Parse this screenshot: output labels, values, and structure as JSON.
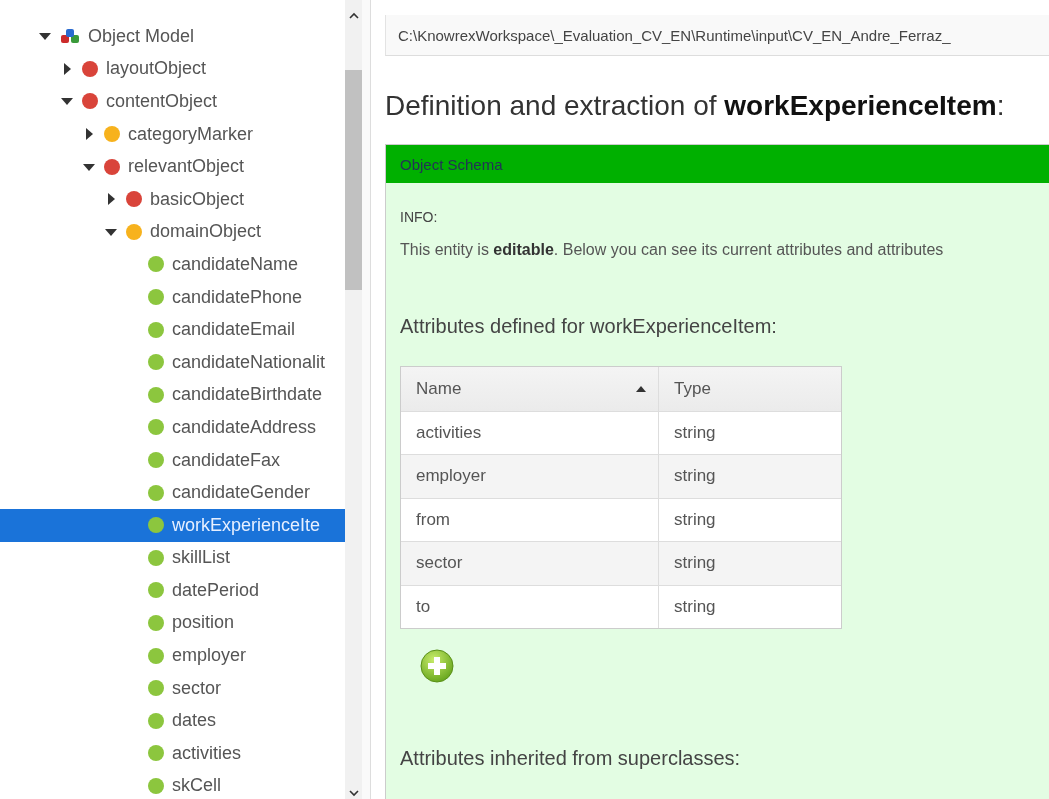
{
  "tree": [
    {
      "label": "Object Model",
      "kind": "model",
      "expanded": true,
      "selected": false,
      "children": [
        {
          "label": "layoutObject",
          "color": "#d9443a",
          "expanded": false,
          "selected": false
        },
        {
          "label": "contentObject",
          "color": "#d9443a",
          "expanded": true,
          "selected": false,
          "children": [
            {
              "label": "categoryMarker",
              "color": "#f7b21d",
              "expanded": false,
              "selected": false
            },
            {
              "label": "relevantObject",
              "color": "#d9443a",
              "expanded": true,
              "selected": false,
              "children": [
                {
                  "label": "basicObject",
                  "color": "#d9443a",
                  "expanded": false,
                  "selected": false
                },
                {
                  "label": "domainObject",
                  "color": "#f7b21d",
                  "expanded": true,
                  "selected": false,
                  "children": [
                    {
                      "label": "candidateName",
                      "color": "#8cc63e",
                      "selected": false
                    },
                    {
                      "label": "candidatePhone",
                      "color": "#8cc63e",
                      "selected": false
                    },
                    {
                      "label": "candidateEmail",
                      "color": "#8cc63e",
                      "selected": false
                    },
                    {
                      "label": "candidateNationalit",
                      "color": "#8cc63e",
                      "selected": false
                    },
                    {
                      "label": "candidateBirthdate",
                      "color": "#8cc63e",
                      "selected": false
                    },
                    {
                      "label": "candidateAddress",
                      "color": "#8cc63e",
                      "selected": false
                    },
                    {
                      "label": "candidateFax",
                      "color": "#8cc63e",
                      "selected": false
                    },
                    {
                      "label": "candidateGender",
                      "color": "#8cc63e",
                      "selected": false
                    },
                    {
                      "label": "workExperienceIte",
                      "color": "#8cc63e",
                      "selected": true
                    },
                    {
                      "label": "skillList",
                      "color": "#8cc63e",
                      "selected": false
                    },
                    {
                      "label": "datePeriod",
                      "color": "#8cc63e",
                      "selected": false
                    },
                    {
                      "label": "position",
                      "color": "#8cc63e",
                      "selected": false
                    },
                    {
                      "label": "employer",
                      "color": "#8cc63e",
                      "selected": false
                    },
                    {
                      "label": "sector",
                      "color": "#8cc63e",
                      "selected": false
                    },
                    {
                      "label": "dates",
                      "color": "#8cc63e",
                      "selected": false
                    },
                    {
                      "label": "activities",
                      "color": "#8cc63e",
                      "selected": false
                    },
                    {
                      "label": "skCell",
                      "color": "#8cc63e",
                      "selected": false
                    }
                  ]
                }
              ]
            }
          ]
        }
      ]
    }
  ],
  "path": "C:\\KnowrexWorkspace\\_Evaluation_CV_EN\\Runtime\\input\\CV_EN_Andre_Ferraz_",
  "heading": "Definition and extraction of **workExperienceItem**:",
  "panel": {
    "title": "Object Schema",
    "info_label": "INFO:",
    "info_text": "This entity is **editable**. Below you can see its current attributes and attributes",
    "attributes_title": "Attributes defined for workExperienceItem:",
    "table": {
      "columns": [
        {
          "label": "Name",
          "sorted": true
        },
        {
          "label": "Type",
          "sorted": false
        }
      ],
      "rows": [
        [
          "activities",
          "string"
        ],
        [
          "employer",
          "string"
        ],
        [
          "from",
          "string"
        ],
        [
          "sector",
          "string"
        ],
        [
          "to",
          "string"
        ]
      ]
    },
    "inherited_title": "Attributes inherited from superclasses:"
  }
}
